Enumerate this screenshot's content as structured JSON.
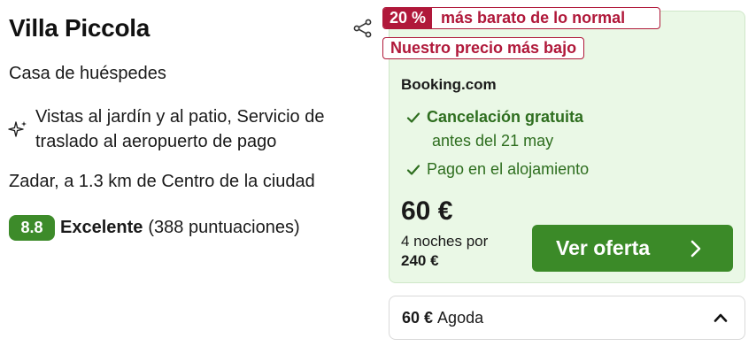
{
  "listing": {
    "name": "Villa Piccola",
    "property_type": "Casa de huéspedes",
    "amenities": "Vistas al jardín y al patio, Servicio de traslado al aeropuerto de pago",
    "location": "Zadar, a 1.3 km de Centro de la ciudad",
    "rating": {
      "score": "8.8",
      "label": "Excelente",
      "count": "(388 puntuaciones)"
    }
  },
  "deal": {
    "discount_pct": "20 %",
    "discount_label": "más barato de lo normal",
    "lowest_price_label": "Nuestro precio más bajo",
    "provider": "Booking.com",
    "cancellation": "Cancelación gratuita",
    "cancellation_deadline": "antes del 21 may",
    "payment": "Pago en el alojamiento",
    "price": "60 €",
    "nights_label": "4 noches por",
    "total": "240 €",
    "cta_label": "Ver oferta"
  },
  "other_offer": {
    "price": "60 €",
    "provider": "Agoda"
  },
  "icons": {
    "share": "share-icon",
    "sparkle": "sparkle-icon",
    "check": "check-icon",
    "chevron_right": "chevron-right-icon",
    "chevron_up": "chevron-up-icon"
  },
  "colors": {
    "accent_green": "#3b8a28",
    "deal_red": "#b0183a",
    "card_bg": "#eaf8e6"
  }
}
